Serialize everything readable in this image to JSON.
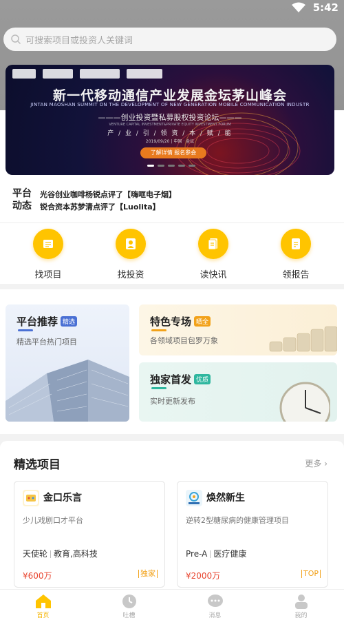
{
  "status": {
    "time": "5:42"
  },
  "search": {
    "placeholder": "可搜索项目或投资人关键词"
  },
  "banner": {
    "title": "新一代移动通信产业发展金坛茅山峰会",
    "subtitle_en": "JINTAN MAOSHAN SUMMIT ON THE DEVELOPMENT OF NEW GENERATION MOBILE COMMUNICATION INDUSTR",
    "subtitle": "———创业投资暨私募股权投资论坛———",
    "subtitle2_en": "VENTURE CAPITAL INVESTMENT&PRIVATE EQUITY INVESTMENT FORUM",
    "tags": "产 / 业 / 引 / 领    资 / 本 / 赋 / 能",
    "date": "2019/09/20 | 中国 · 金坛",
    "button": "了解详情  报名参会",
    "dots": 5,
    "active_dot": 0
  },
  "news": {
    "label": "平台动态",
    "items": [
      "光谷创业咖啡杨锐点评了【嗨哐电子烟】",
      "锐合资本苏梦清点评了【Luolita】"
    ]
  },
  "quick_actions": [
    {
      "label": "找项目",
      "icon": "project-list-icon"
    },
    {
      "label": "找投资",
      "icon": "investor-icon"
    },
    {
      "label": "读快讯",
      "icon": "news-doc-icon"
    },
    {
      "label": "领报告",
      "icon": "report-icon"
    }
  ],
  "cards": {
    "recommend": {
      "title": "平台推荐",
      "tag": "精选",
      "desc": "精选平台热门项目",
      "color": "#4a70d4"
    },
    "feature": {
      "title": "特色专场",
      "tag": "晒全",
      "desc": "各领域项目包罗万象",
      "color": "#f2a21a"
    },
    "exclusive": {
      "title": "独家首发",
      "tag": "优质",
      "desc": "实时更新发布",
      "color": "#2fb79f"
    }
  },
  "featured": {
    "title": "精选项目",
    "more": "更多",
    "projects": [
      {
        "name": "金口乐言",
        "desc": "少儿戏剧口才平台",
        "stage": "天使轮",
        "field": "教育,高科技",
        "amount": "¥600万",
        "badge": "独家"
      },
      {
        "name": "焕然新生",
        "desc": "逆转2型糖尿病的健康管理项目",
        "stage": "Pre-A",
        "field": "医疗健康",
        "amount": "¥2000万",
        "badge": "TOP"
      }
    ]
  },
  "tabbar": [
    {
      "label": "首页",
      "icon": "home-icon",
      "active": true
    },
    {
      "label": "吐槽",
      "icon": "clock-icon",
      "active": false
    },
    {
      "label": "消息",
      "icon": "message-icon",
      "active": false
    },
    {
      "label": "我的",
      "icon": "user-icon",
      "active": false
    }
  ],
  "colors": {
    "accent": "#ffc400",
    "price": "#e8452f",
    "badge": "#f2a21a"
  }
}
